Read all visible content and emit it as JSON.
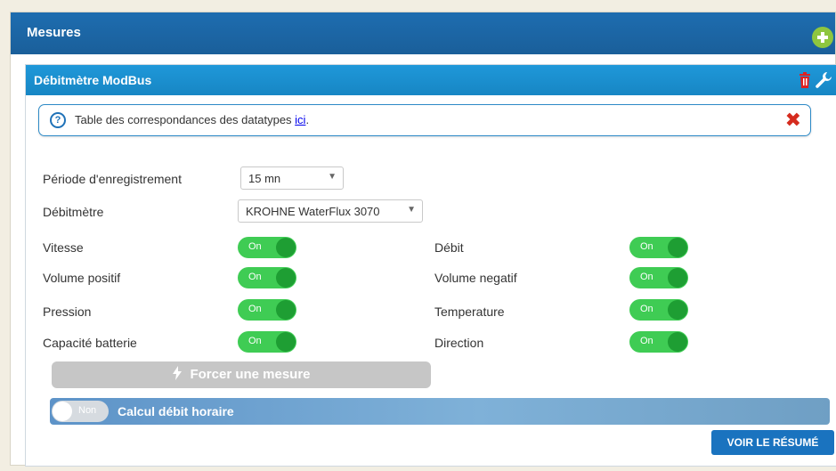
{
  "main": {
    "title": "Mesures",
    "add_icon": "plus-circle-icon"
  },
  "card": {
    "title": "Débitmètre ModBus",
    "delete_icon": "trash-icon",
    "settings_icon": "wrench-icon"
  },
  "info": {
    "text": "Table des correspondances des datatypes ",
    "link": "ici",
    "suffix": ".",
    "help_icon": "question-circle-icon",
    "close_icon": "close-icon",
    "help_glyph": "?",
    "close_glyph": "✖"
  },
  "form": {
    "period_label": "Période d'enregistrement",
    "period_value": "15 mn",
    "meter_label": "Débitmètre",
    "meter_value": "KROHNE WaterFlux 3070"
  },
  "toggles": {
    "vitesse": {
      "label": "Vitesse",
      "state": "On"
    },
    "debit": {
      "label": "Débit",
      "state": "On"
    },
    "volume_positif": {
      "label": "Volume positif",
      "state": "On"
    },
    "volume_negatif": {
      "label": "Volume negatif",
      "state": "On"
    },
    "pression": {
      "label": "Pression",
      "state": "On"
    },
    "temperature": {
      "label": "Temperature",
      "state": "On"
    },
    "capacite_batterie": {
      "label": "Capacité batterie",
      "state": "On"
    },
    "direction": {
      "label": "Direction",
      "state": "On"
    }
  },
  "force_button": {
    "label": "Forcer une mesure",
    "icon": "bolt-icon"
  },
  "calc": {
    "state": "Non",
    "label": "Calcul débit horaire"
  },
  "summary_button": {
    "label": "VOIR LE RÉSUMÉ"
  },
  "colors": {
    "header_blue": "#1e6db0",
    "card_blue": "#1f98d9",
    "toggle_on": "#3fcc54",
    "danger": "#d52b1e",
    "add_green": "#8ec63f"
  }
}
